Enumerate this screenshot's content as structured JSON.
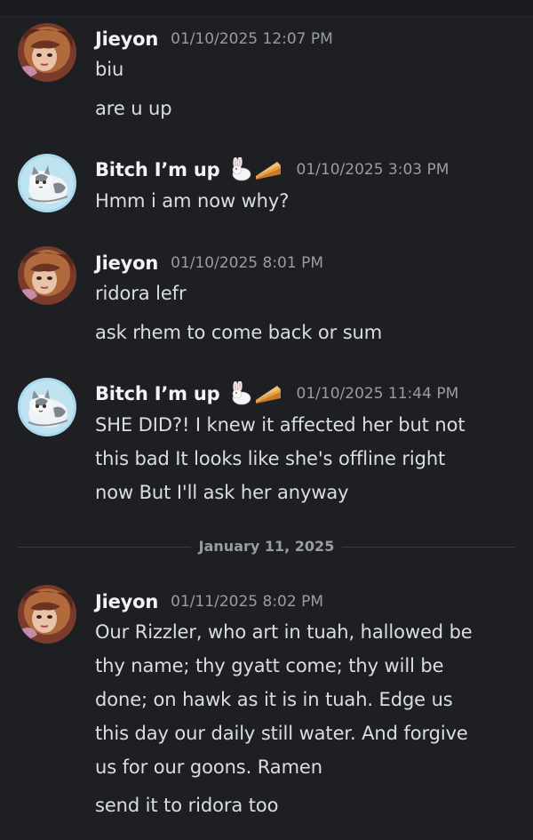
{
  "messages": [
    {
      "username": "Jieyon",
      "timestamp": "01/10/2025 12:07 PM",
      "avatar": "jieyon-avatar",
      "lines": [
        "biu",
        "are u up"
      ]
    },
    {
      "username": "Bitch I’m up",
      "timestamp": "01/10/2025 3:03 PM",
      "avatar": "cat-avatar",
      "decorations": [
        "rabbit-icon",
        "pie-icon"
      ],
      "lines": [
        "Hmm i am now why?"
      ]
    },
    {
      "username": "Jieyon",
      "timestamp": "01/10/2025 8:01 PM",
      "avatar": "jieyon-avatar",
      "lines": [
        "ridora lefr",
        "ask rhem to come back or sum"
      ]
    },
    {
      "username": "Bitch I’m up",
      "timestamp": "01/10/2025 11:44 PM",
      "avatar": "cat-avatar",
      "decorations": [
        "rabbit-icon",
        "pie-icon"
      ],
      "lines": [
        "SHE DID?! I knew it affected her but not",
        "this bad It looks like she's offline right",
        "now But I'll ask her anyway"
      ]
    },
    {
      "username": "Jieyon",
      "timestamp": "01/11/2025 8:02 PM",
      "avatar": "jieyon-avatar",
      "lines": [
        "Our Rizzler, who art in tuah, hallowed be",
        "thy name; thy gyatt come; thy will be",
        "done; on hawk as it is in tuah. Edge us",
        "this day our daily still water. And forgive",
        "us for our goons. Ramen",
        "send it to ridora too"
      ]
    }
  ],
  "date_divider": "January 11, 2025",
  "colors": {
    "background": "#1e1f23",
    "username": "#f2f3f5",
    "text": "#dbdee1",
    "timestamp": "#9a9ca3",
    "divider": "#3b3d44"
  }
}
